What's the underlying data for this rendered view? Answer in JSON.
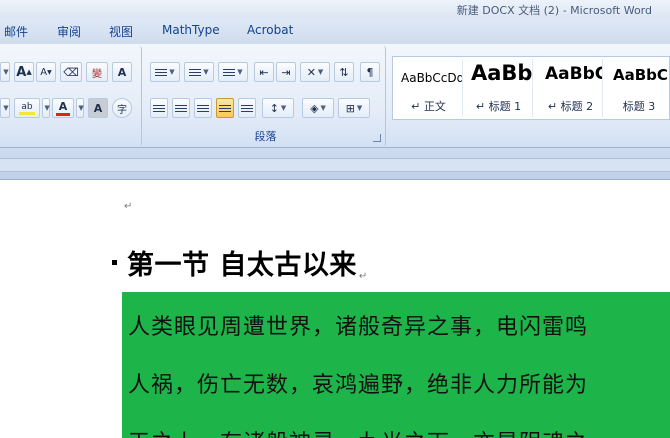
{
  "window": {
    "title": "新建 DOCX 文档 (2) - Microsoft Word"
  },
  "menu_tabs": [
    "邮件",
    "审阅",
    "视图",
    "MathType",
    "Acrobat"
  ],
  "ribbon": {
    "font_group": {
      "grow_font_glyph": "A",
      "shrink_font_glyph": "A",
      "highlight_glyph": "ab",
      "font_color_glyph": "A",
      "char_border_glyph": "A",
      "char_shading_glyph": "A",
      "enclose_char_glyph": "字"
    },
    "paragraph_group": {
      "label": "段落"
    },
    "styles": [
      {
        "sample": "AaBbCcDd",
        "label": "↵ 正文"
      },
      {
        "sample": "AaBb",
        "label": "↵ 标题 1"
      },
      {
        "sample": "AaBbC",
        "label": "↵ 标题 2"
      },
      {
        "sample": "AaBbC",
        "label": "标题 3"
      }
    ]
  },
  "document": {
    "para_mark": "↵",
    "heading": "第一节  自太古以来",
    "body_lines": [
      "人类眼见周遭世界，诸般奇异之事，电闪雷鸣",
      "人祸，伤亡无数，哀鸿遍野，绝非人力所能为",
      "天之上，有诸般神灵，九光之下，亦是阴魂之"
    ]
  },
  "colors": {
    "highlight": "#1db54a",
    "ribbon": "#dfe9f6",
    "tab_text": "#15428b"
  }
}
